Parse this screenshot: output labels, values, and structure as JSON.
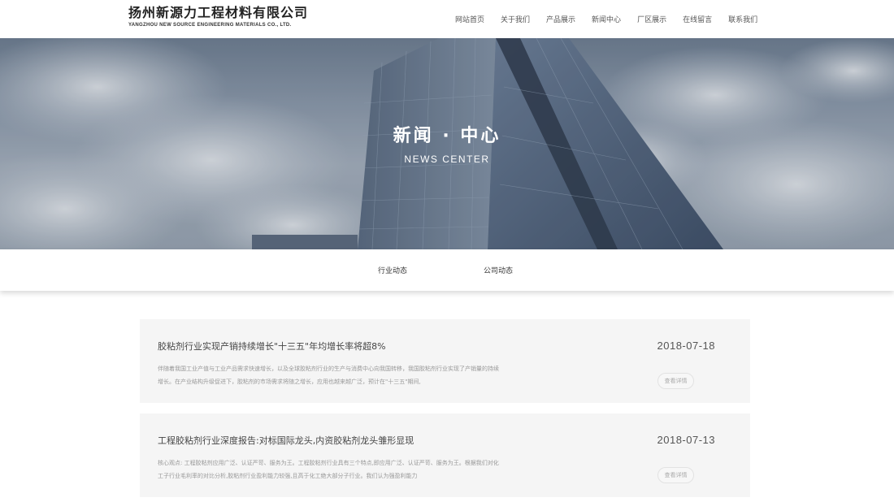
{
  "header": {
    "logo_cn": "扬州新源力工程材料有限公司",
    "logo_en": "YANGZHOU NEW SOURCE ENGINEERING MATERIALS CO., LTD.",
    "nav": [
      "网站首页",
      "关于我们",
      "产品展示",
      "新闻中心",
      "厂区展示",
      "在线留言",
      "联系我们"
    ]
  },
  "banner": {
    "title": "新闻 · 中心",
    "subtitle": "NEWS CENTER"
  },
  "tabs": [
    "行业动态",
    "公司动态"
  ],
  "news": [
    {
      "title": "胶粘剂行业实现产销持续增长\"十三五\"年均增长率将超8%",
      "date": "2018-07-18",
      "desc": "伴随着我国工业产值与工业产品需求快速增长，以及全球胶粘剂行业的生产与消费中心向我国转移，我国胶粘剂行业实现了产销量的持续增长。在产业结构升级促进下，胶粘剂的市场需求将随之增长，应用也越来越广泛，预计在\"十三五\"期间,",
      "button": "查看详情"
    },
    {
      "title": "工程胶粘剂行业深度报告:对标国际龙头,内资胶粘剂龙头雏形显现",
      "date": "2018-07-13",
      "desc": "核心观点: 工程胶粘剂应用广泛、认证严苛、服务为王。工程胶粘剂行业具有三个特点,即应用广泛、认证严苛、服务为王。根据我们对化工子行业毛利率的对比分析,胶粘剂行业盈利能力较强,且高于化工绝大部分子行业。我们认为强盈利能力",
      "button": "查看详情"
    }
  ]
}
